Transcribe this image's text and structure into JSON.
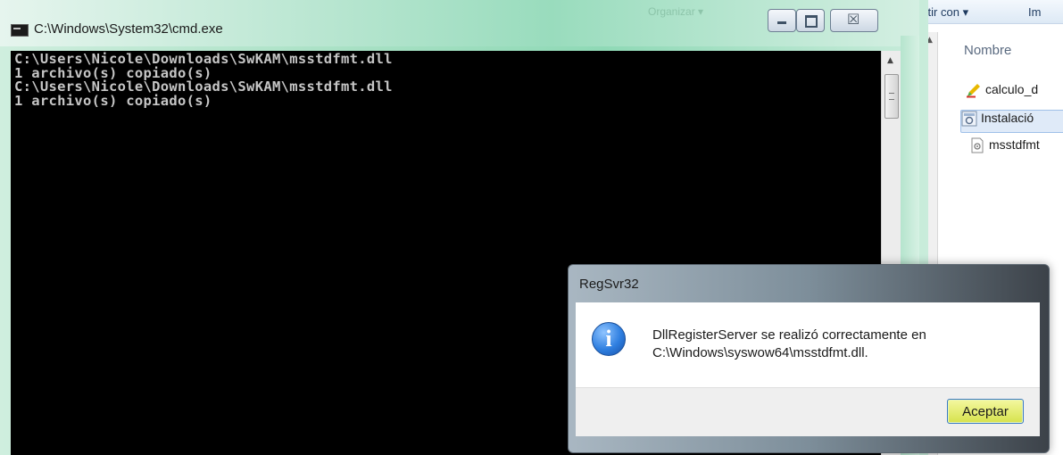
{
  "explorer": {
    "toolbar": {
      "share_label": "artir con ▾",
      "next_label": "Im"
    },
    "faded_toolbar_item": "Organizar ▾",
    "column_header": "Nombre",
    "files": [
      {
        "name": "calculo_d",
        "icon": "pencil-document-icon"
      },
      {
        "name": "Instalació",
        "icon": "setup-file-icon"
      },
      {
        "name": "msstdfmt",
        "icon": "dll-file-icon"
      }
    ]
  },
  "cmd": {
    "title": "C:\\Windows\\System32\\cmd.exe",
    "lines": [
      "C:\\Users\\Nicole\\Downloads\\SwKAM\\msstdfmt.dll",
      "1 archivo(s) copiado(s)",
      "C:\\Users\\Nicole\\Downloads\\SwKAM\\msstdfmt.dll",
      "1 archivo(s) copiado(s)"
    ],
    "caption_close_glyph": "☒"
  },
  "dialog": {
    "title": "RegSvr32",
    "message_line1": "DllRegisterServer se realizó correctamente en",
    "message_line2": "C:\\Windows\\syswow64\\msstdfmt.dll.",
    "ok_label": "Aceptar"
  },
  "colors": {
    "console_bg": "#000000",
    "console_text": "#c6c6c6",
    "glass_frame": "#a6e0c3",
    "accept_button": "#d6e24c"
  }
}
